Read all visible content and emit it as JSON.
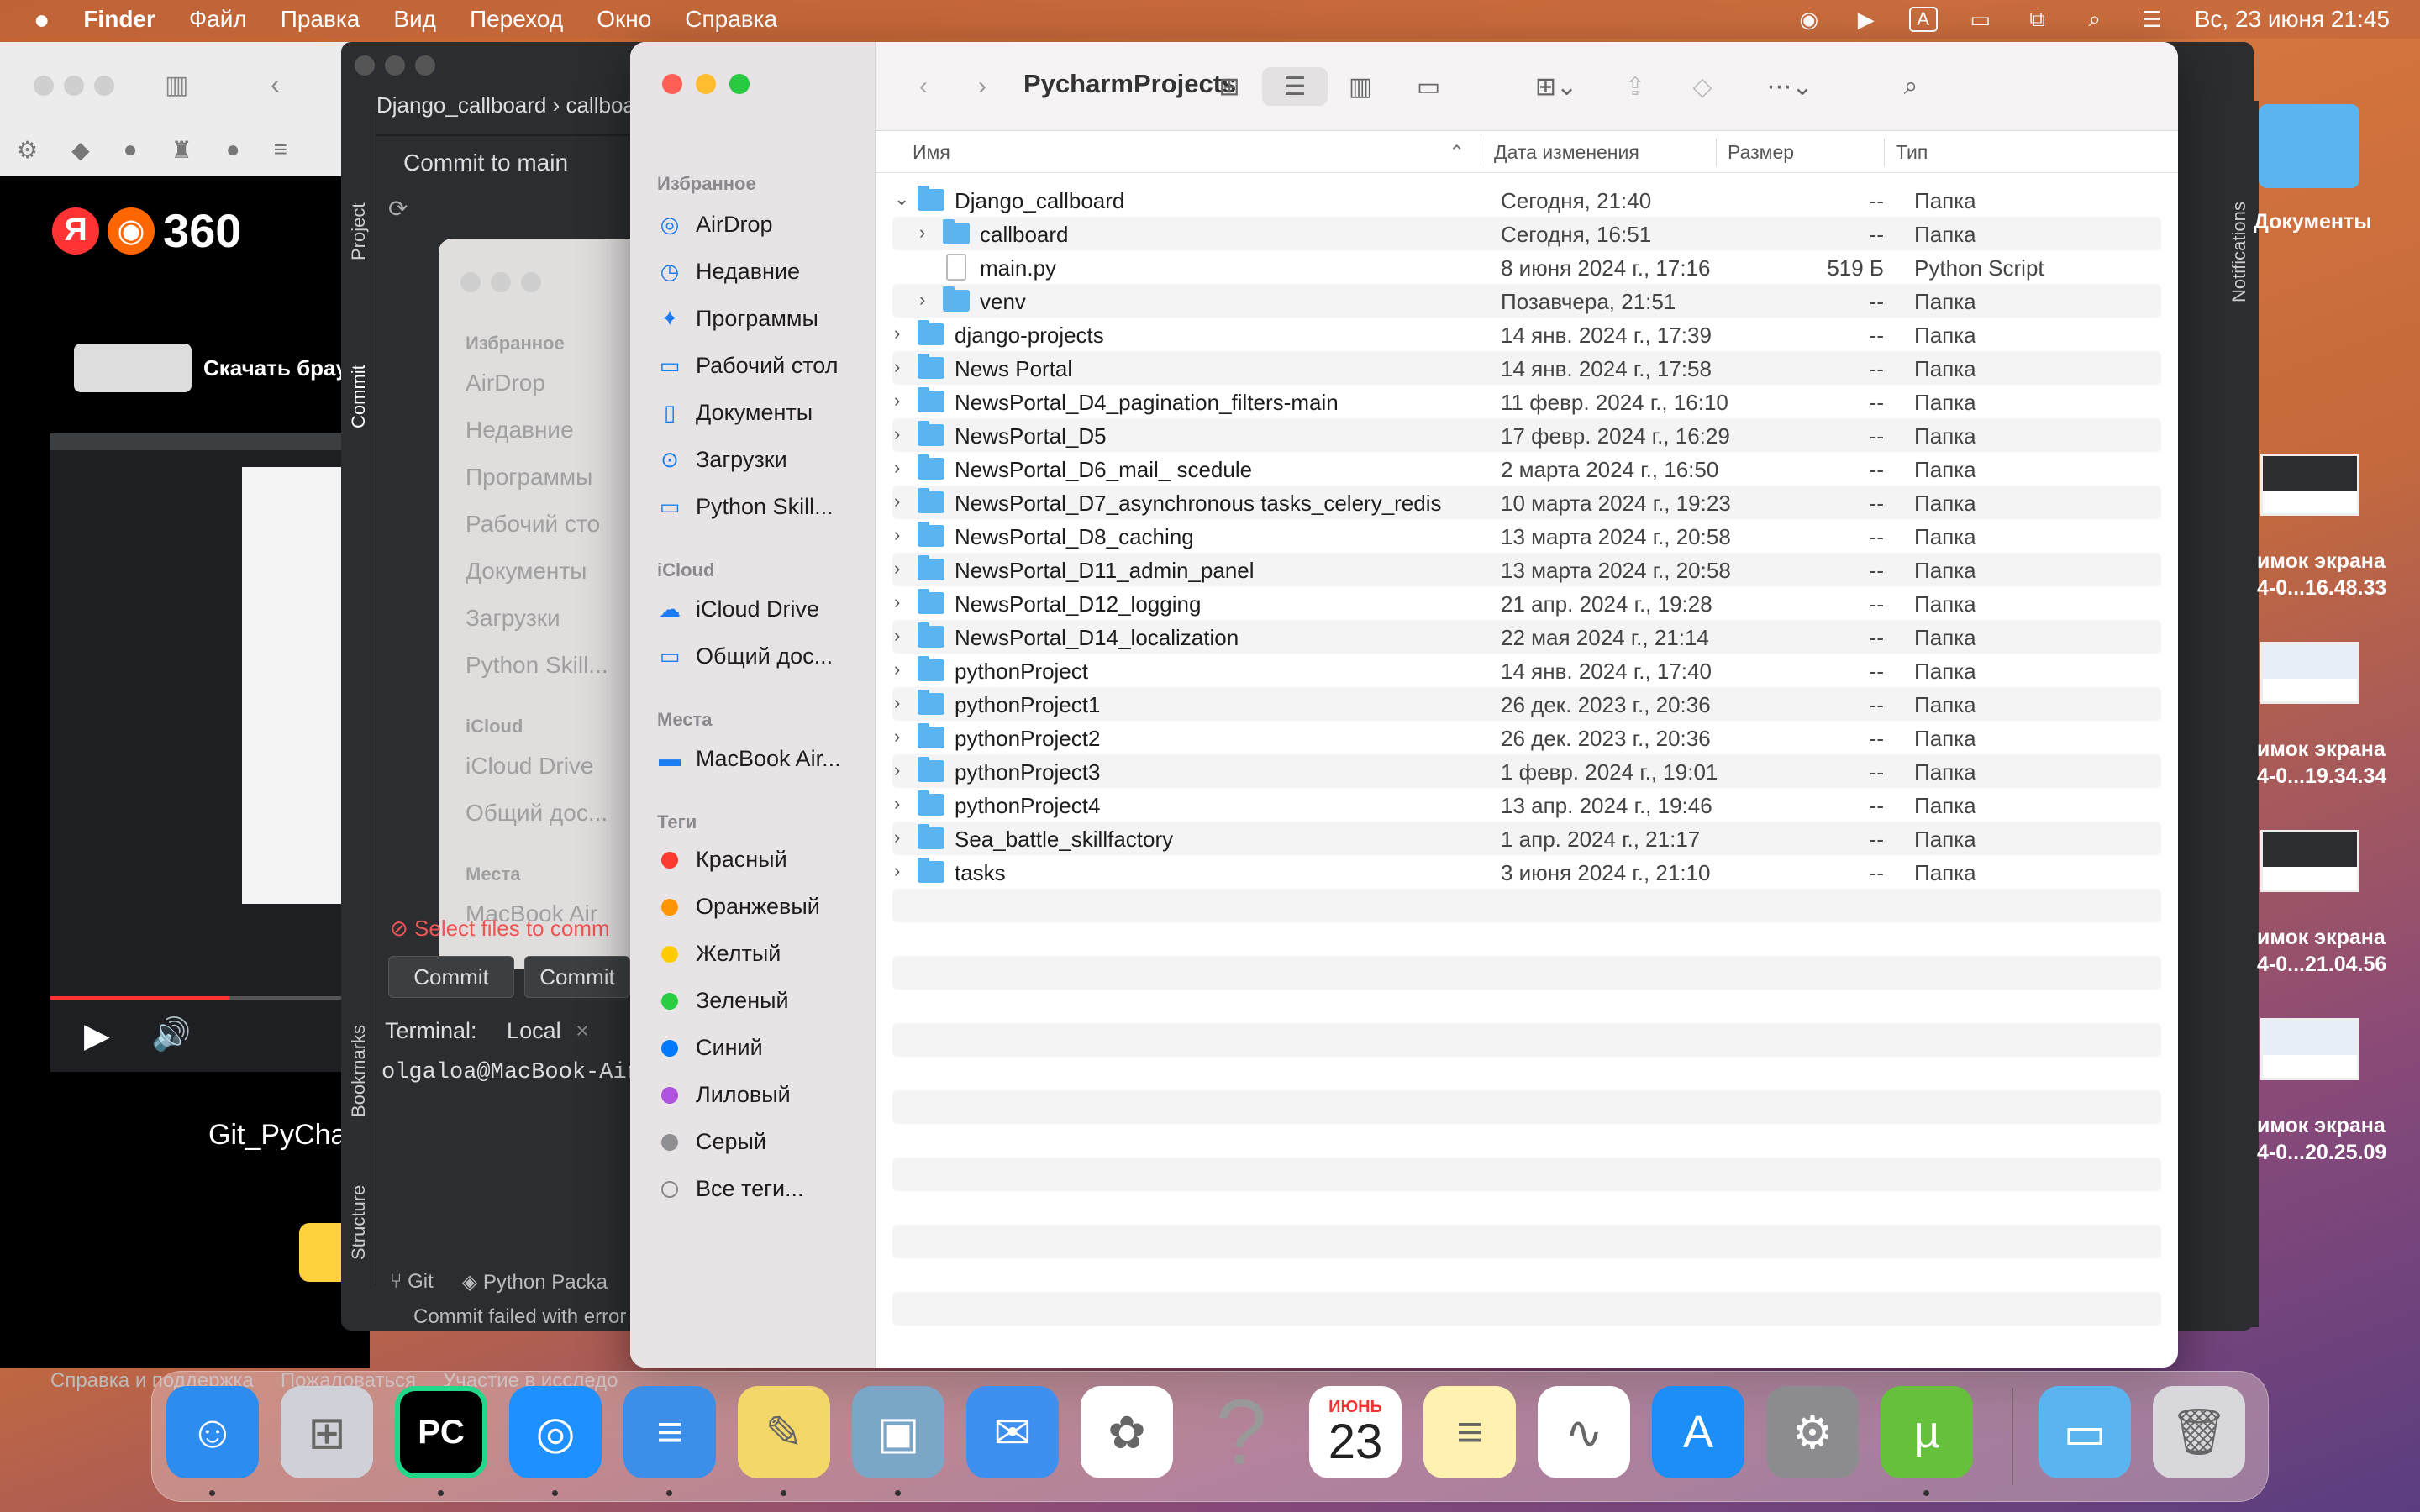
{
  "menubar": {
    "apple": "",
    "items": [
      "Finder",
      "Файл",
      "Правка",
      "Вид",
      "Переход",
      "Окно",
      "Справка"
    ],
    "input_indicator": "A",
    "clock": "Вс, 23 июня  21:45"
  },
  "browser": {
    "brand": "360",
    "download": "Скачать брау",
    "video_title": "Git_PyCha",
    "footer": [
      "Справка и поддержка",
      "Пожаловаться",
      "Участие в исследо"
    ]
  },
  "pycharm": {
    "breadcrumb": "Django_callboard ›  callboa",
    "commit_to": "Commit to main",
    "side_labels": [
      "Project",
      "Commit",
      "Bookmarks",
      "Structure"
    ],
    "error": "Select files to comm",
    "btn_commit": "Commit",
    "btn_commit2": "Commit",
    "terminal_label": "Terminal:",
    "terminal_tab": "Local",
    "prompt": "olgaloa@MacBook-Air",
    "bottom_tabs": [
      "Git",
      "Python Packa"
    ],
    "status": "Commit failed with error",
    "ghost": {
      "fav": "Избранное",
      "items": [
        "AirDrop",
        "Недавние",
        "Программы",
        "Рабочий сто",
        "Документы",
        "Загрузки",
        "Python Skill..."
      ],
      "icloud": "iCloud",
      "icloud_items": [
        "iCloud Drive",
        "Общий доc..."
      ],
      "places": "Места",
      "place_items": [
        "MacBook Air"
      ]
    }
  },
  "finder": {
    "title": "PycharmProjects",
    "sidebar": {
      "favorites_header": "Избранное",
      "favorites": [
        {
          "label": "AirDrop",
          "icon": "airdrop-icon",
          "glyph": "◎"
        },
        {
          "label": "Недавние",
          "icon": "clock-icon",
          "glyph": "◷"
        },
        {
          "label": "Программы",
          "icon": "applications-icon",
          "glyph": "✦"
        },
        {
          "label": "Рабочий стол",
          "icon": "desktop-icon",
          "glyph": "▭"
        },
        {
          "label": "Документы",
          "icon": "document-icon",
          "glyph": "▯"
        },
        {
          "label": "Загрузки",
          "icon": "download-icon",
          "glyph": "⊙"
        },
        {
          "label": "Python Skill...",
          "icon": "folder-icon",
          "glyph": "▭"
        }
      ],
      "icloud_header": "iCloud",
      "icloud": [
        {
          "label": "iCloud Drive",
          "icon": "cloud-icon",
          "glyph": "☁"
        },
        {
          "label": "Общий доc...",
          "icon": "shared-folder-icon",
          "glyph": "▭"
        }
      ],
      "places_header": "Места",
      "places": [
        {
          "label": "MacBook Air...",
          "icon": "laptop-icon",
          "glyph": "▬"
        }
      ],
      "tags_header": "Теги",
      "tags": [
        {
          "label": "Красный",
          "color": "#ff3b30"
        },
        {
          "label": "Оранжевый",
          "color": "#ff9500"
        },
        {
          "label": "Желтый",
          "color": "#ffcc00"
        },
        {
          "label": "Зеленый",
          "color": "#28cd41"
        },
        {
          "label": "Синий",
          "color": "#007aff"
        },
        {
          "label": "Лиловый",
          "color": "#af52de"
        },
        {
          "label": "Серый",
          "color": "#8e8e93"
        }
      ],
      "all_tags": "Все теги..."
    },
    "columns": {
      "name": "Имя",
      "date": "Дата изменения",
      "size": "Размер",
      "kind": "Тип"
    },
    "rows": [
      {
        "name": "Django_callboard",
        "date": "Сегодня, 21:40",
        "size": "--",
        "kind": "Папка",
        "level": 0,
        "expanded": true,
        "type": "folder"
      },
      {
        "name": "callboard",
        "date": "Сегодня, 16:51",
        "size": "--",
        "kind": "Папка",
        "level": 1,
        "expanded": false,
        "type": "folder"
      },
      {
        "name": "main.py",
        "date": "8 июня 2024 г., 17:16",
        "size": "519 Б",
        "kind": "Python Script",
        "level": 1,
        "expanded": null,
        "type": "file"
      },
      {
        "name": "venv",
        "date": "Позавчера, 21:51",
        "size": "--",
        "kind": "Папка",
        "level": 1,
        "expanded": false,
        "type": "folder"
      },
      {
        "name": "django-projects",
        "date": "14 янв. 2024 г., 17:39",
        "size": "--",
        "kind": "Папка",
        "level": 0,
        "expanded": false,
        "type": "folder"
      },
      {
        "name": "News Portal",
        "date": "14 янв. 2024 г., 17:58",
        "size": "--",
        "kind": "Папка",
        "level": 0,
        "expanded": false,
        "type": "folder"
      },
      {
        "name": "NewsPortal_D4_pagination_filters-main",
        "date": "11 февр. 2024 г., 16:10",
        "size": "--",
        "kind": "Папка",
        "level": 0,
        "expanded": false,
        "type": "folder"
      },
      {
        "name": "NewsPortal_D5",
        "date": "17 февр. 2024 г., 16:29",
        "size": "--",
        "kind": "Папка",
        "level": 0,
        "expanded": false,
        "type": "folder"
      },
      {
        "name": "NewsPortal_D6_mail_ scedule",
        "date": "2 марта 2024 г., 16:50",
        "size": "--",
        "kind": "Папка",
        "level": 0,
        "expanded": false,
        "type": "folder"
      },
      {
        "name": "NewsPortal_D7_asynchronous tasks_celery_redis",
        "date": "10 марта 2024 г., 19:23",
        "size": "--",
        "kind": "Папка",
        "level": 0,
        "expanded": false,
        "type": "folder"
      },
      {
        "name": "NewsPortal_D8_caching",
        "date": "13 марта 2024 г., 20:58",
        "size": "--",
        "kind": "Папка",
        "level": 0,
        "expanded": false,
        "type": "folder"
      },
      {
        "name": "NewsPortal_D11_admin_panel",
        "date": "13 марта 2024 г., 20:58",
        "size": "--",
        "kind": "Папка",
        "level": 0,
        "expanded": false,
        "type": "folder"
      },
      {
        "name": "NewsPortal_D12_logging",
        "date": "21 апр. 2024 г., 19:28",
        "size": "--",
        "kind": "Папка",
        "level": 0,
        "expanded": false,
        "type": "folder"
      },
      {
        "name": "NewsPortal_D14_localization",
        "date": "22 мая 2024 г., 21:14",
        "size": "--",
        "kind": "Папка",
        "level": 0,
        "expanded": false,
        "type": "folder"
      },
      {
        "name": "pythonProject",
        "date": "14 янв. 2024 г., 17:40",
        "size": "--",
        "kind": "Папка",
        "level": 0,
        "expanded": false,
        "type": "folder"
      },
      {
        "name": "pythonProject1",
        "date": "26 дек. 2023 г., 20:36",
        "size": "--",
        "kind": "Папка",
        "level": 0,
        "expanded": false,
        "type": "folder"
      },
      {
        "name": "pythonProject2",
        "date": "26 дек. 2023 г., 20:36",
        "size": "--",
        "kind": "Папка",
        "level": 0,
        "expanded": false,
        "type": "folder"
      },
      {
        "name": "pythonProject3",
        "date": "1 февр. 2024 г., 19:01",
        "size": "--",
        "kind": "Папка",
        "level": 0,
        "expanded": false,
        "type": "folder"
      },
      {
        "name": "pythonProject4",
        "date": "13 апр. 2024 г., 19:46",
        "size": "--",
        "kind": "Папка",
        "level": 0,
        "expanded": false,
        "type": "folder"
      },
      {
        "name": "Sea_battle_skillfactory",
        "date": "1 апр. 2024 г., 21:17",
        "size": "--",
        "kind": "Папка",
        "level": 0,
        "expanded": false,
        "type": "folder"
      },
      {
        "name": "tasks",
        "date": "3 июня 2024 г., 21:10",
        "size": "--",
        "kind": "Папка",
        "level": 0,
        "expanded": false,
        "type": "folder"
      }
    ]
  },
  "desktop": {
    "folder_label": "Документы",
    "screenshots": [
      {
        "line1": "имок экрана",
        "line2": "4-0...16.48.33"
      },
      {
        "line1": "имок экрана",
        "line2": "4-0...19.34.34"
      },
      {
        "line1": "имок экрана",
        "line2": "4-0...21.04.56"
      },
      {
        "line1": "имок экрана",
        "line2": "4-0...20.25.09"
      }
    ],
    "notifications": "Notifications"
  },
  "dock": {
    "calendar_month": "ИЮНЬ",
    "calendar_day": "23",
    "apps": [
      {
        "name": "finder",
        "color": "#2d8cf0"
      },
      {
        "name": "launchpad",
        "color": "#d0d0d8"
      },
      {
        "name": "pycharm",
        "color": "#21d789"
      },
      {
        "name": "safari",
        "color": "#1e90ff"
      },
      {
        "name": "pages",
        "color": "#3b8fe8"
      },
      {
        "name": "stickies",
        "color": "#f3d768"
      },
      {
        "name": "preview",
        "color": "#7aa6c8"
      },
      {
        "name": "mail",
        "color": "#3d8ff0"
      },
      {
        "name": "photos",
        "color": "#ffffff"
      },
      {
        "name": "help",
        "color": "transparent"
      },
      {
        "name": "calendar",
        "color": "#ffffff"
      },
      {
        "name": "notes",
        "color": "#fff2b0"
      },
      {
        "name": "freeform",
        "color": "#ffffff"
      },
      {
        "name": "app-store",
        "color": "#1c8ef5"
      },
      {
        "name": "system-settings",
        "color": "#8c8c90"
      },
      {
        "name": "utorrent",
        "color": "#65c13c"
      },
      {
        "name": "downloads-folder",
        "color": "#5ab4f0"
      },
      {
        "name": "trash",
        "color": "#d8d8dc"
      }
    ]
  }
}
